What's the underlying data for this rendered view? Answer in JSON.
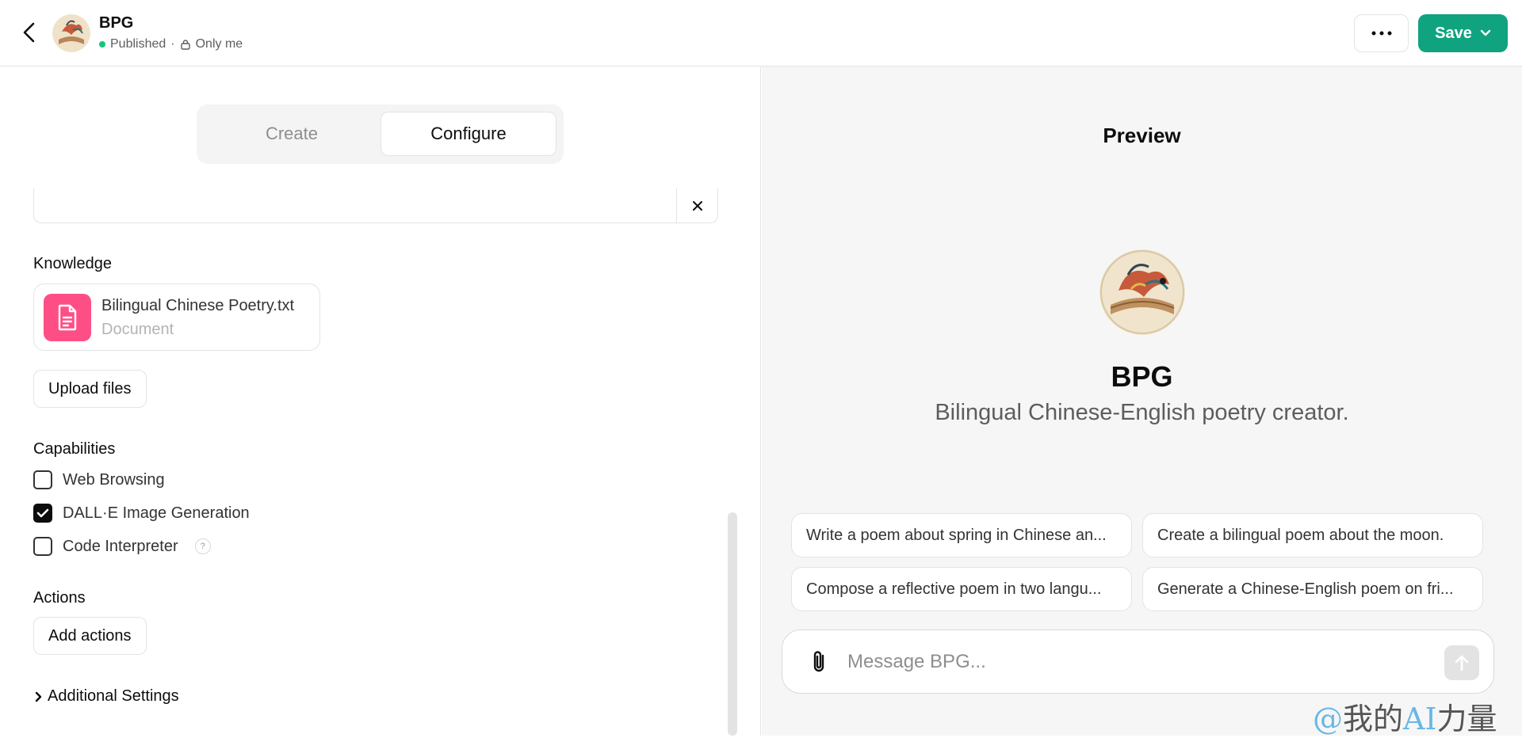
{
  "header": {
    "gpt_name": "BPG",
    "status": "Published",
    "separator": "·",
    "visibility": "Only me",
    "save_label": "Save"
  },
  "tabs": {
    "create": "Create",
    "configure": "Configure"
  },
  "knowledge": {
    "label": "Knowledge",
    "file_name": "Bilingual Chinese Poetry.txt",
    "file_type": "Document",
    "upload_label": "Upload files"
  },
  "capabilities": {
    "label": "Capabilities",
    "items": [
      {
        "label": "Web Browsing",
        "checked": false
      },
      {
        "label": "DALL·E Image Generation",
        "checked": true
      },
      {
        "label": "Code Interpreter",
        "checked": false
      }
    ],
    "help": "?"
  },
  "actions": {
    "label": "Actions",
    "add_label": "Add actions"
  },
  "additional_settings": "Additional Settings",
  "preview": {
    "title": "Preview",
    "name": "BPG",
    "description": "Bilingual Chinese-English poetry creator.",
    "suggestions": [
      "Write a poem about spring in Chinese an...",
      "Create a bilingual poem about the moon.",
      "Compose a reflective poem in two langu...",
      "Generate a Chinese-English poem on fri..."
    ],
    "placeholder": "Message BPG..."
  },
  "watermark": {
    "at": "@",
    "cn1": "我的",
    "ai": "AI",
    "cn2": "力量"
  },
  "colors": {
    "save": "#10a37f",
    "file_icon": "#fd4f86",
    "published_dot": "#19c37d"
  }
}
